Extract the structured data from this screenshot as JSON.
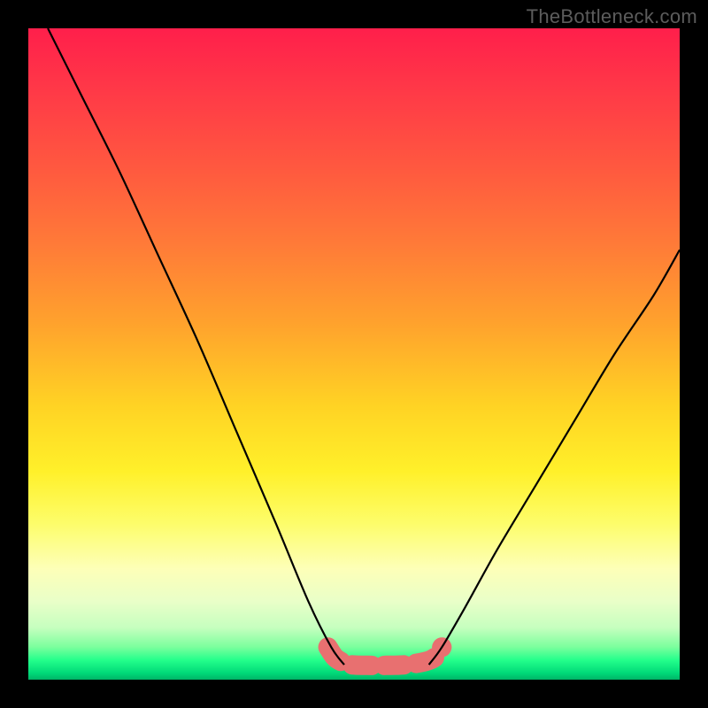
{
  "watermark": "TheBottleneck.com",
  "chart_data": {
    "type": "line",
    "title": "",
    "xlabel": "",
    "ylabel": "",
    "xlim": [
      0,
      100
    ],
    "ylim": [
      0,
      100
    ],
    "series": [
      {
        "name": "curve-left",
        "x": [
          3,
          8,
          14,
          20,
          26,
          32,
          38,
          43,
          46.5,
          48.5
        ],
        "y": [
          100,
          90,
          78,
          65,
          52,
          38,
          24,
          12,
          5,
          2.3
        ]
      },
      {
        "name": "curve-right",
        "x": [
          61.5,
          63.5,
          67,
          72,
          78,
          84,
          90,
          96,
          100
        ],
        "y": [
          2.3,
          5,
          11,
          20,
          30,
          40,
          50,
          59,
          66
        ]
      },
      {
        "name": "bottom-blob",
        "x": [
          46,
          47,
          48,
          49.5,
          52,
          55,
          58,
          61,
          62.5,
          63.5
        ],
        "y": [
          5,
          3.5,
          2.8,
          2.3,
          2.2,
          2.2,
          2.3,
          2.8,
          3.5,
          5
        ]
      }
    ],
    "blob_style": {
      "stroke": "#e87070",
      "stroke_width_plot": 22
    },
    "curve_style": {
      "stroke": "#000000",
      "stroke_width_px": 2.2
    }
  }
}
